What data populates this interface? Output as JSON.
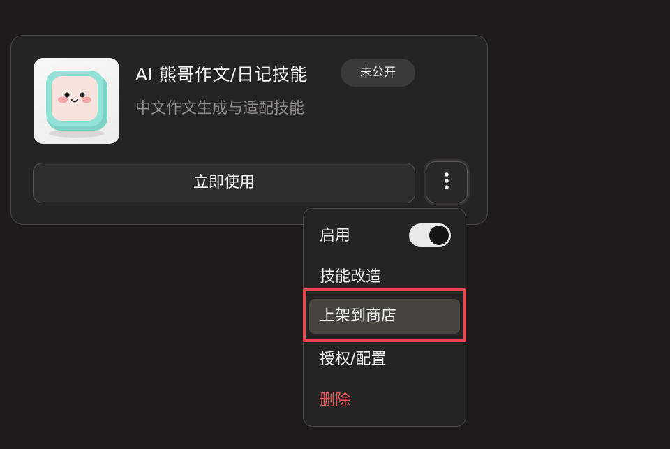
{
  "card": {
    "title": "AI 熊哥作文/日记技能",
    "badge": "未公开",
    "subtitle": "中文作文生成与适配技能",
    "use_button_label": "立即使用"
  },
  "menu": {
    "enable_label": "启用",
    "enable_on": true,
    "items": [
      {
        "label": "技能改造"
      },
      {
        "label": "上架到商店",
        "highlighted": true
      },
      {
        "label": "授权/配置"
      },
      {
        "label": "删除",
        "danger": true
      }
    ]
  },
  "colors": {
    "background": "#1f1b1b",
    "card": "#262323",
    "danger": "#e9555c",
    "annotation": "#e8484f"
  }
}
